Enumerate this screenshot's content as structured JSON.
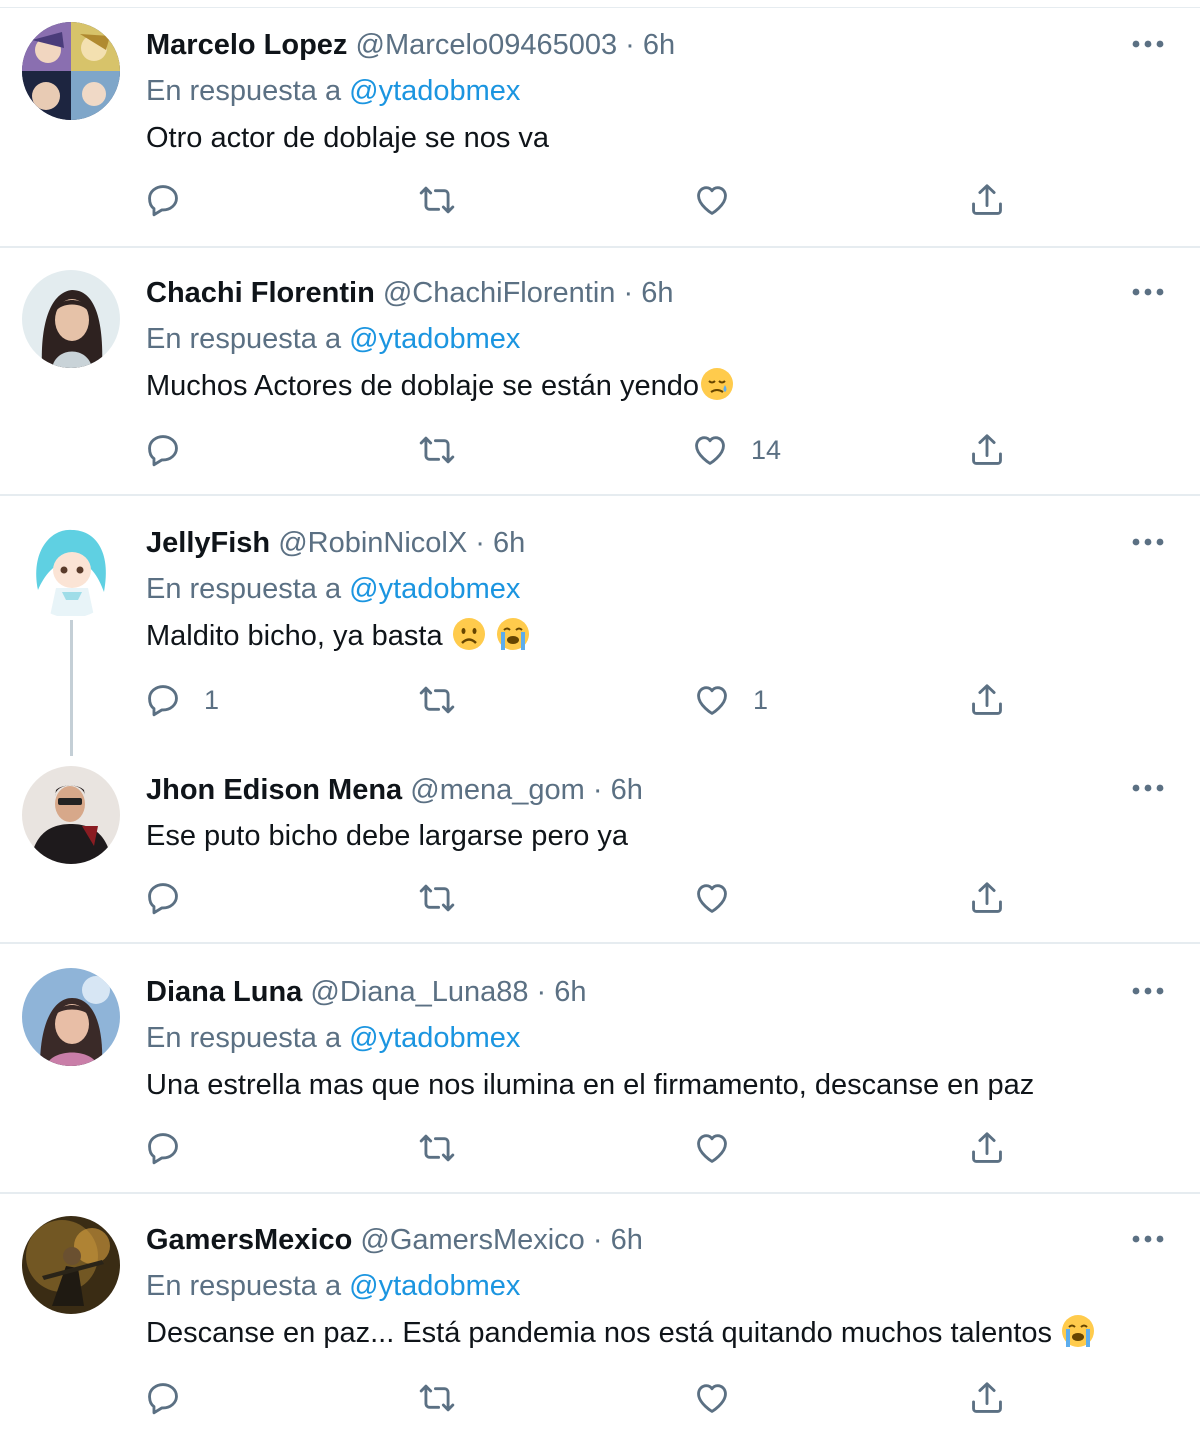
{
  "reply_prefix": "En respuesta a",
  "reply_mention": "@ytadobmex",
  "tweets": [
    {
      "name": "Marcelo Lopez",
      "handle": "@Marcelo09465003",
      "dot": "·",
      "time": "6h",
      "reply": true,
      "text": "Otro actor de doblaje se nos va",
      "reply_count": "",
      "like_count": ""
    },
    {
      "name": "Chachi Florentin",
      "handle": "@ChachiFlorentin",
      "dot": "·",
      "time": "6h",
      "reply": true,
      "text": "Muchos Actores de doblaje se están yendo",
      "reply_count": "",
      "like_count": "14"
    },
    {
      "name": "JellyFish",
      "handle": "@RobinNicolX",
      "dot": "·",
      "time": "6h",
      "reply": true,
      "text": "Maldito bicho, ya basta ",
      "reply_count": "1",
      "like_count": "1"
    },
    {
      "name": "Jhon Edison Mena",
      "handle": "@mena_gom",
      "dot": "·",
      "time": "6h",
      "reply": false,
      "text": "Ese puto bicho debe largarse pero ya",
      "reply_count": "",
      "like_count": ""
    },
    {
      "name": "Diana Luna",
      "handle": "@Diana_Luna88",
      "dot": "·",
      "time": "6h",
      "reply": true,
      "text": "Una estrella mas que nos ilumina en el firmamento, descanse en paz",
      "reply_count": "",
      "like_count": ""
    },
    {
      "name": "GamersMexico",
      "handle": "@GamersMexico",
      "dot": "·",
      "time": "6h",
      "reply": true,
      "text": "Descanse en paz... Está pandemia nos está quitando muchos talentos ",
      "reply_count": "",
      "like_count": ""
    }
  ],
  "icons": {
    "reply": "reply-icon",
    "retweet": "retweet-icon",
    "like": "heart-icon",
    "share": "share-icon",
    "more": "more-icon"
  },
  "colors": {
    "text": "#0f1419",
    "secondary": "#5b7083",
    "link": "#1b95e0",
    "divider": "#e6ecf0",
    "icon": "#5b7083"
  }
}
